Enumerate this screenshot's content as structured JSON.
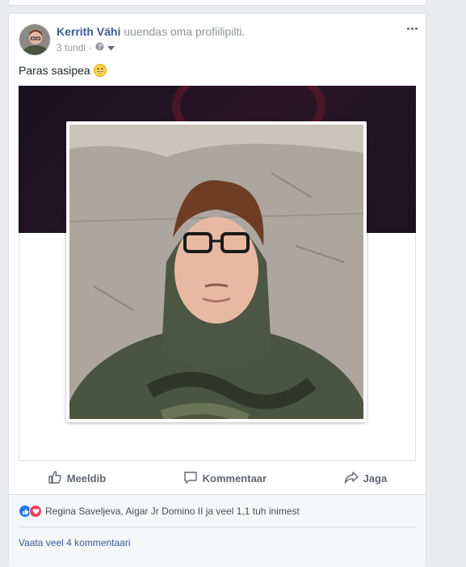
{
  "post": {
    "author": "Kerrith Vähi",
    "action_text": "uuendas oma profiilipilti.",
    "time": "3 tundi",
    "privacy_icon": "globe-icon",
    "text": "Paras sasipea",
    "emoji": "grinning-face-emoji"
  },
  "actions": {
    "like": "Meeldib",
    "comment": "Kommentaar",
    "share": "Jaga"
  },
  "reactions": {
    "icons": [
      "like-reaction-icon",
      "love-reaction-icon"
    ],
    "text": "Regina Saveljeva, Aigar Jr Domino II ja veel 1,1 tuh inimest"
  },
  "comments": {
    "view_more": "Vaata veel 4 kommentaari"
  },
  "colors": {
    "link": "#385898",
    "muted": "#90949c",
    "like_blue": "#1877f2",
    "love_red": "#f33e58"
  }
}
